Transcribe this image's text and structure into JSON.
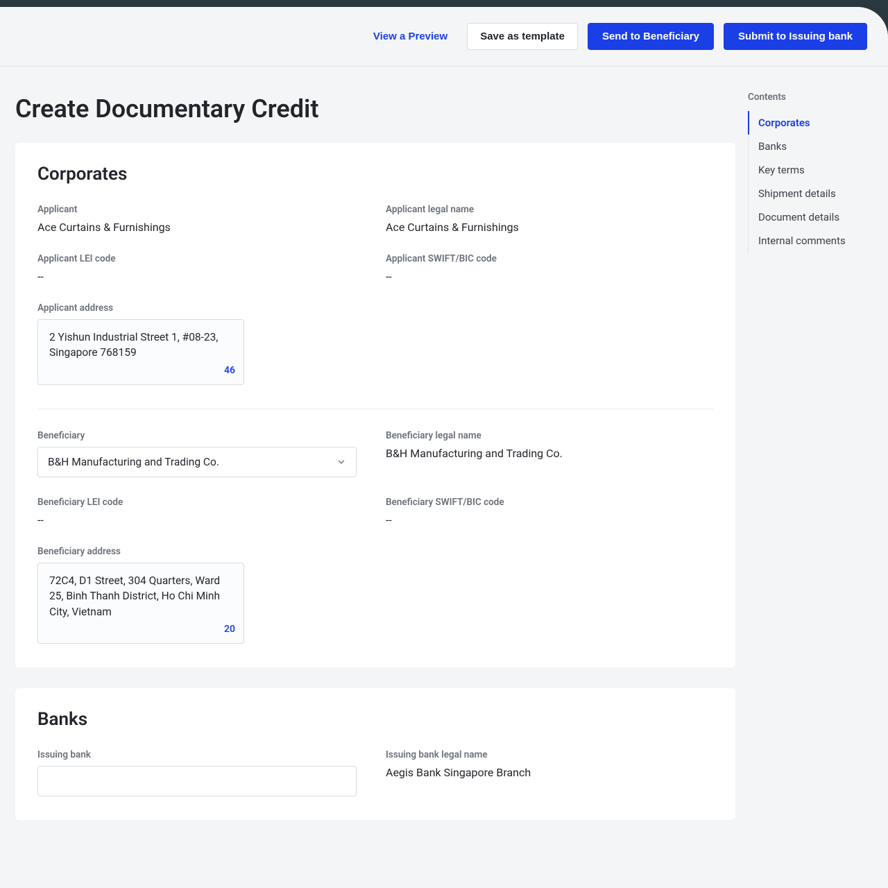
{
  "topbar": {
    "preview": "View a Preview",
    "save_template": "Save as template",
    "send_beneficiary": "Send to Beneficiary",
    "submit_bank": "Submit to Issuing bank"
  },
  "page_title": "Create Documentary Credit",
  "contents": {
    "heading": "Contents",
    "items": [
      "Corporates",
      "Banks",
      "Key terms",
      "Shipment details",
      "Document details",
      "Internal comments"
    ],
    "active_index": 0
  },
  "sections": {
    "corporates": {
      "title": "Corporates",
      "applicant": {
        "label": "Applicant",
        "value": "Ace Curtains & Furnishings",
        "legal_name_label": "Applicant legal name",
        "legal_name_value": "Ace Curtains & Furnishings",
        "lei_label": "Applicant LEI code",
        "lei_value": "--",
        "swift_label": "Applicant SWIFT/BIC code",
        "swift_value": "--",
        "address_label": "Applicant address",
        "address_value": "2 Yishun Industrial Street 1, #08-23, Singapore 768159",
        "address_count": "46"
      },
      "beneficiary": {
        "label": "Beneficiary",
        "select_value": "B&H Manufacturing and Trading Co.",
        "legal_name_label": "Beneficiary legal name",
        "legal_name_value": "B&H Manufacturing and Trading Co.",
        "lei_label": "Beneficiary LEI code",
        "lei_value": "--",
        "swift_label": "Beneficiary SWIFT/BIC code",
        "swift_value": "--",
        "address_label": "Beneficiary address",
        "address_value": "72C4, D1 Street, 304 Quarters, Ward 25, Binh Thanh District, Ho Chi Minh City, Vietnam",
        "address_count": "20"
      }
    },
    "banks": {
      "title": "Banks",
      "issuing_label": "Issuing bank",
      "issuing_legal_label": "Issuing bank legal name",
      "issuing_legal_value": "Aegis Bank Singapore Branch"
    }
  }
}
